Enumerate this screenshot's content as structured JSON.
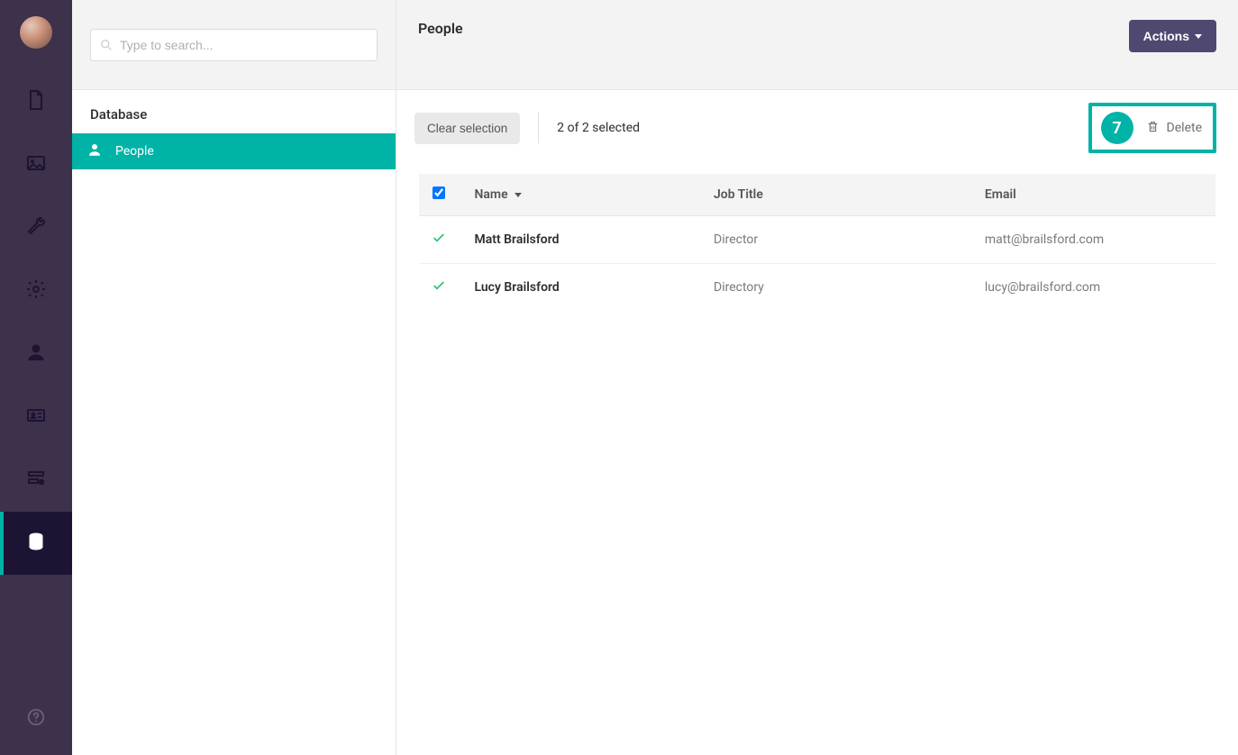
{
  "search": {
    "placeholder": "Type to search..."
  },
  "sidebar": {
    "section": "Database",
    "tree_item": "People"
  },
  "header": {
    "title": "People",
    "actions_label": "Actions"
  },
  "toolbar": {
    "clear_label": "Clear selection",
    "selection_status": "2 of 2 selected",
    "delete_label": "Delete",
    "step_badge": "7"
  },
  "table": {
    "columns": {
      "name": "Name",
      "job": "Job Title",
      "email": "Email"
    },
    "rows": [
      {
        "name": "Matt Brailsford",
        "job": "Director",
        "email": "matt@brailsford.com"
      },
      {
        "name": "Lucy Brailsford",
        "job": "Directory",
        "email": "lucy@brailsford.com"
      }
    ]
  },
  "colors": {
    "accent": "#00b3a7",
    "rail": "#3d314b",
    "actions_btn": "#4f4870"
  }
}
